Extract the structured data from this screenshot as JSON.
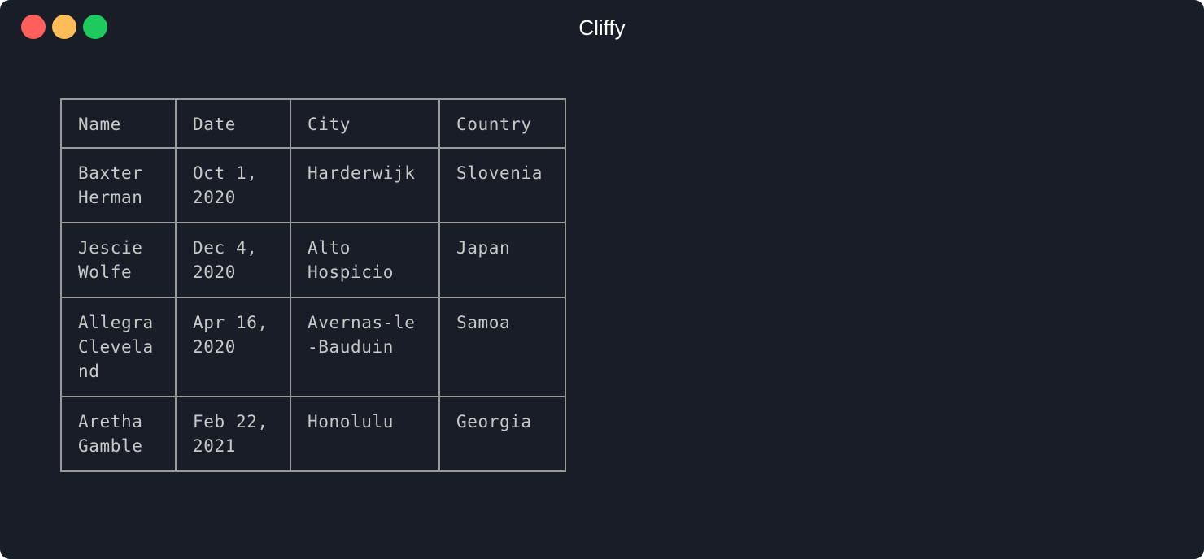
{
  "window": {
    "title": "Cliffy",
    "controls": [
      "close",
      "minimize",
      "maximize"
    ]
  },
  "table": {
    "headers": [
      "Name",
      "Date",
      "City",
      "Country"
    ],
    "rows": [
      [
        "Baxter\nHerman",
        "Oct 1,\n2020",
        "Harderwijk",
        "Slovenia"
      ],
      [
        "Jescie\nWolfe",
        "Dec 4,\n2020",
        "Alto\nHospicio",
        "Japan"
      ],
      [
        "Allegra\nClevela\nnd",
        "Apr 16,\n2020",
        "Avernas-le\n-Bauduin",
        "Samoa"
      ],
      [
        "Aretha\nGamble",
        "Feb 22,\n2021",
        "Honolulu",
        "Georgia"
      ]
    ]
  }
}
